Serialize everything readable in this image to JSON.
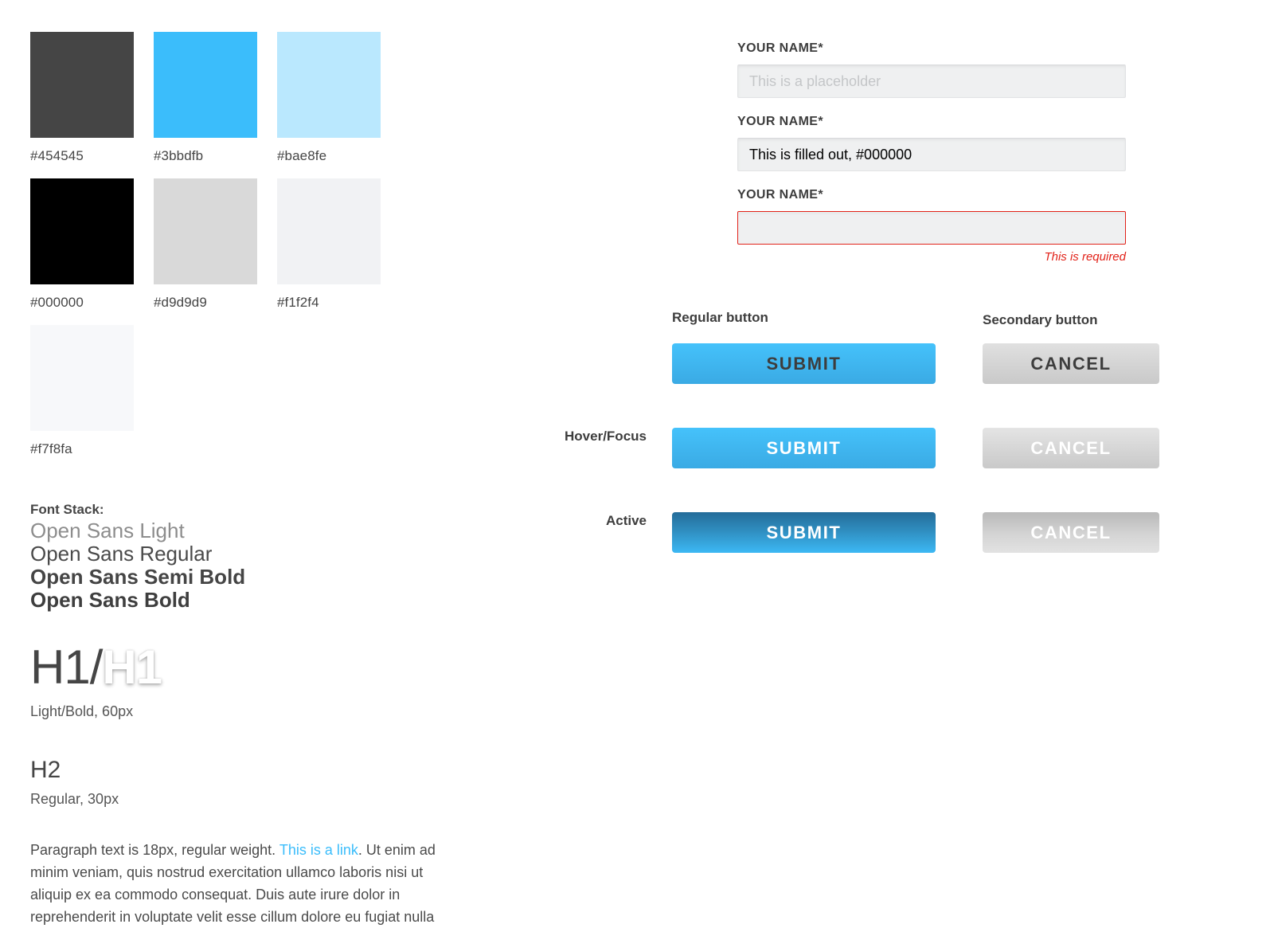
{
  "palette": {
    "swatches": [
      {
        "hex": "#454545",
        "label": "#454545"
      },
      {
        "hex": "#3bbdfb",
        "label": "#3bbdfb"
      },
      {
        "hex": "#bae8fe",
        "label": "#bae8fe"
      },
      {
        "hex": "#000000",
        "label": "#000000"
      },
      {
        "hex": "#d9d9d9",
        "label": "#d9d9d9"
      },
      {
        "hex": "#f1f2f4",
        "label": "#f1f2f4"
      },
      {
        "hex": "#f7f8fa",
        "label": "#f7f8fa"
      }
    ]
  },
  "typography": {
    "font_stack_title": "Font Stack:",
    "weights": [
      "Open Sans Light",
      "Open Sans Regular",
      "Open Sans Semi Bold",
      "Open Sans Bold"
    ],
    "h1_light_text": "H1/",
    "h1_bold_text": "H1",
    "h1_caption": "Light/Bold, 60px",
    "h2_text": "H2",
    "h2_caption": "Regular, 30px",
    "paragraph_before_link": "Paragraph text is 18px, regular weight. ",
    "paragraph_link": "This is a link",
    "paragraph_after_link": ". Ut enim ad minim veniam, quis nostrud exercitation ullamco laboris nisi ut aliquip ex ea commodo consequat. Duis aute irure dolor in reprehenderit in voluptate velit esse cillum dolore eu fugiat nulla"
  },
  "form": {
    "fields": [
      {
        "label": "YOUR NAME*",
        "value": "",
        "placeholder": "This is a placeholder",
        "state": "placeholder"
      },
      {
        "label": "YOUR NAME*",
        "value": "This is filled out, #000000",
        "placeholder": "",
        "state": "filled"
      },
      {
        "label": "YOUR NAME*",
        "value": "",
        "placeholder": "",
        "state": "error",
        "error_message": "This is required"
      }
    ]
  },
  "buttons": {
    "column_titles": {
      "primary": "Regular button",
      "secondary": "Secondary button"
    },
    "state_labels": {
      "regular": "",
      "hover": "Hover/Focus",
      "active": "Active"
    },
    "primary_label": "SUBMIT",
    "secondary_label": "CANCEL"
  },
  "colors": {
    "brand_blue": "#3bbdfb",
    "brand_blue_light": "#bae8fe",
    "dark_gray": "#454545",
    "error_red": "#e2231a",
    "input_bg": "#eff0f1"
  }
}
